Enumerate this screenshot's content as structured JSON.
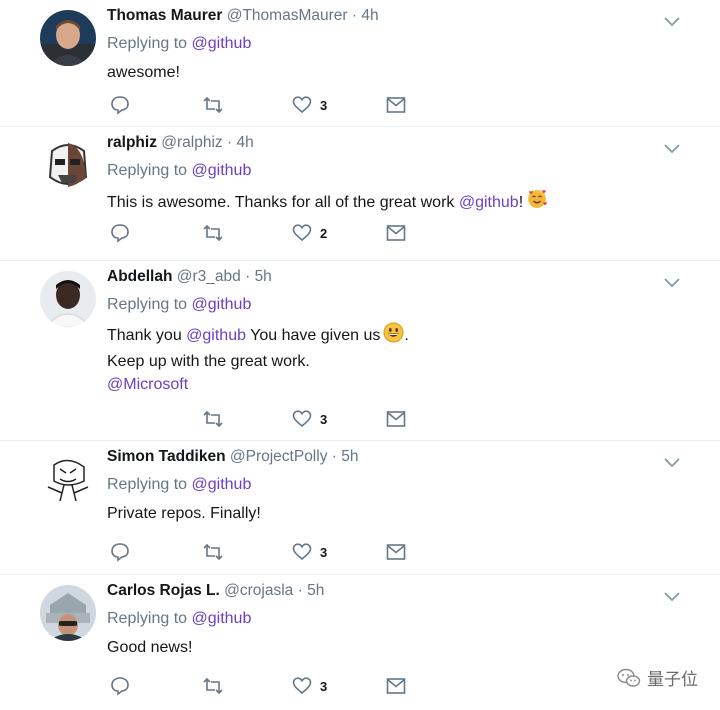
{
  "reply_prefix": "Replying to",
  "tweets": [
    {
      "name": "Thomas Maurer",
      "handle": "@ThomasMaurer",
      "separator": "·",
      "time": "4h",
      "replying_to": "@github",
      "lines": [
        {
          "text": "awesome!"
        }
      ],
      "likes": "3"
    },
    {
      "name": "ralphiz",
      "handle": "@ralphiz",
      "separator": "·",
      "time": "4h",
      "replying_to": "@github",
      "text_before": "This is awesome. Thanks for all of the great work ",
      "mention": "@github",
      "text_after": "!",
      "emoji": "smiling-face-with-hearts",
      "likes": "2"
    },
    {
      "name": "Abdellah",
      "handle": "@r3_abd",
      "separator": "·",
      "time": "5h",
      "replying_to": "@github",
      "text_before": "Thank you ",
      "mention": "@github",
      "text_after": " You have given us",
      "emoji": "grinning-face",
      "text_end": ".",
      "line2": "Keep up with the great work.",
      "line3_mention": "@Microsoft",
      "likes": "3"
    },
    {
      "name": "Simon Taddiken",
      "handle": "@ProjectPolly",
      "separator": "·",
      "time": "5h",
      "replying_to": "@github",
      "text": "Private repos. Finally!",
      "likes": "3"
    },
    {
      "name": "Carlos Rojas L.",
      "handle": "@crojasla",
      "separator": "·",
      "time": "5h",
      "replying_to": "@github",
      "text": "Good news!",
      "likes": "3"
    }
  ],
  "watermark": "量子位",
  "colors": {
    "mention": "#6d3fc5",
    "meta": "#657786",
    "divider": "#e6ecf0"
  }
}
